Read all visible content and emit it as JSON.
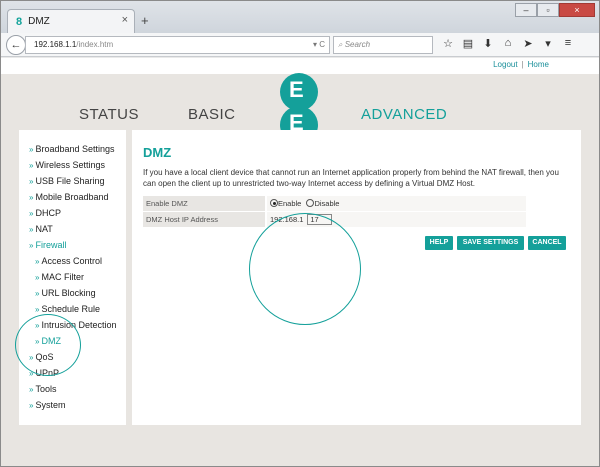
{
  "browser": {
    "tab_title": "DMZ",
    "tab_icon": "8",
    "tab_close": "×",
    "new_tab": "+",
    "url_host": "192.168.1.1",
    "url_path": "/index.htm",
    "search_placeholder": "Search",
    "win_min": "–",
    "win_max": "▫",
    "win_close": "×"
  },
  "top_links": {
    "logout": "Logout",
    "home": "Home"
  },
  "nav": {
    "status": "STATUS",
    "basic": "BASIC",
    "advanced": "ADVANCED"
  },
  "logo": {
    "letter": "E"
  },
  "sidebar": {
    "items": [
      "Broadband Settings",
      "Wireless Settings",
      "USB File Sharing",
      "Mobile Broadband",
      "DHCP",
      "NAT",
      "Firewall",
      "Access Control",
      "MAC Filter",
      "URL Blocking",
      "Schedule Rule",
      "Intrusion Detection",
      "DMZ",
      "QoS",
      "UPnP",
      "Tools",
      "System"
    ]
  },
  "content": {
    "title": "DMZ",
    "description": "If you have a local client device that cannot run an Internet application properly from behind the NAT firewall, then you can open the client up to unrestricted two-way Internet access by defining a Virtual DMZ Host.",
    "enable_label": "Enable DMZ",
    "enable_option": "Enable",
    "disable_option": "Disable",
    "selected_option": "Enable",
    "host_ip_label": "DMZ Host IP Address",
    "ip_prefix": "192.168.1",
    "ip_last": "17",
    "buttons": {
      "help": "HELP",
      "save": "SAVE SETTINGS",
      "cancel": "CANCEL"
    }
  },
  "colors": {
    "accent": "#14a09a",
    "page_bg": "#e8e5e1"
  }
}
